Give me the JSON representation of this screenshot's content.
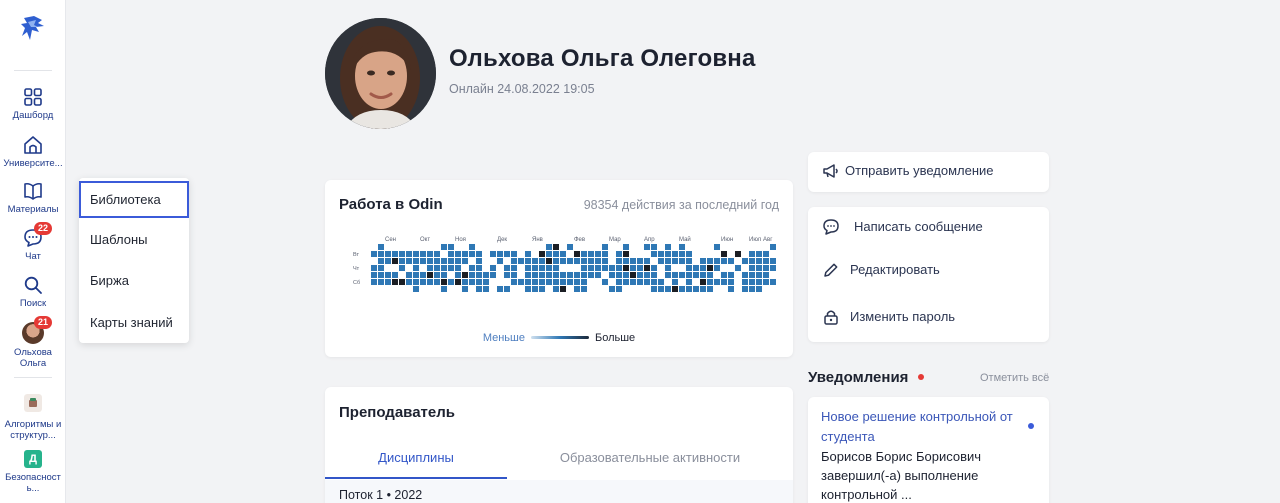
{
  "sidebar": {
    "nav": [
      {
        "label": "Дашборд",
        "icon": "dashboard-icon"
      },
      {
        "label": "Университе...",
        "icon": "university-icon"
      },
      {
        "label": "Материалы",
        "icon": "book-icon"
      },
      {
        "label": "Чат",
        "icon": "chat-icon",
        "badge": "22"
      },
      {
        "label": "Поиск",
        "icon": "search-icon"
      }
    ],
    "profile": {
      "line1": "Ольхова",
      "line2": "Ольга",
      "badge": "21"
    },
    "courses": [
      {
        "line1": "Алгоритмы и",
        "line2": "структур...",
        "icon_color": "#f0e9e4"
      },
      {
        "line1": "Безопасност",
        "line2": "ь...",
        "letter": "Д",
        "icon_color": "#26b38c"
      }
    ]
  },
  "materials_menu": {
    "items": [
      "Библиотека",
      "Шаблоны",
      "Биржа",
      "Карты знаний"
    ],
    "active_index": 0
  },
  "profile": {
    "name": "Ольхова Ольга Олеговна",
    "online": "Онлайн 24.08.2022 19:05"
  },
  "activity": {
    "title": "Работа в Odin",
    "count_text": "98354 действия за последний год",
    "months": [
      "Сен",
      "Окт",
      "Ноя",
      "Дек",
      "Янв",
      "Фев",
      "Мар",
      "Апр",
      "Май",
      "Июн",
      "Июл",
      "Авг"
    ],
    "days": [
      "Вт",
      "Чт",
      "Сб"
    ],
    "legend_less": "Меньше",
    "legend_more": "Больше",
    "colors": {
      "high": "#2f78b5",
      "max": "#1b1e24",
      "empty": "#ffffff"
    }
  },
  "teacher": {
    "title": "Преподаватель",
    "tabs": [
      "Дисциплины",
      "Образовательные активности"
    ],
    "active_tab": 0,
    "stream": "Поток 1 • 2022"
  },
  "actions": {
    "send_notification": "Отправить уведомление",
    "write_message": "Написать сообщение",
    "edit": "Редактировать",
    "change_password": "Изменить пароль"
  },
  "notifications": {
    "title": "Уведомления",
    "mark_all": "Отметить всё",
    "items": [
      {
        "title": "Новое решение контрольной от студента",
        "body": "Борисов Борис Борисович завершил(-а) выполнение контрольной ..."
      }
    ]
  },
  "colors": {
    "accent": "#3256c8",
    "badge": "#e53935",
    "heat": "#2f78b5"
  }
}
